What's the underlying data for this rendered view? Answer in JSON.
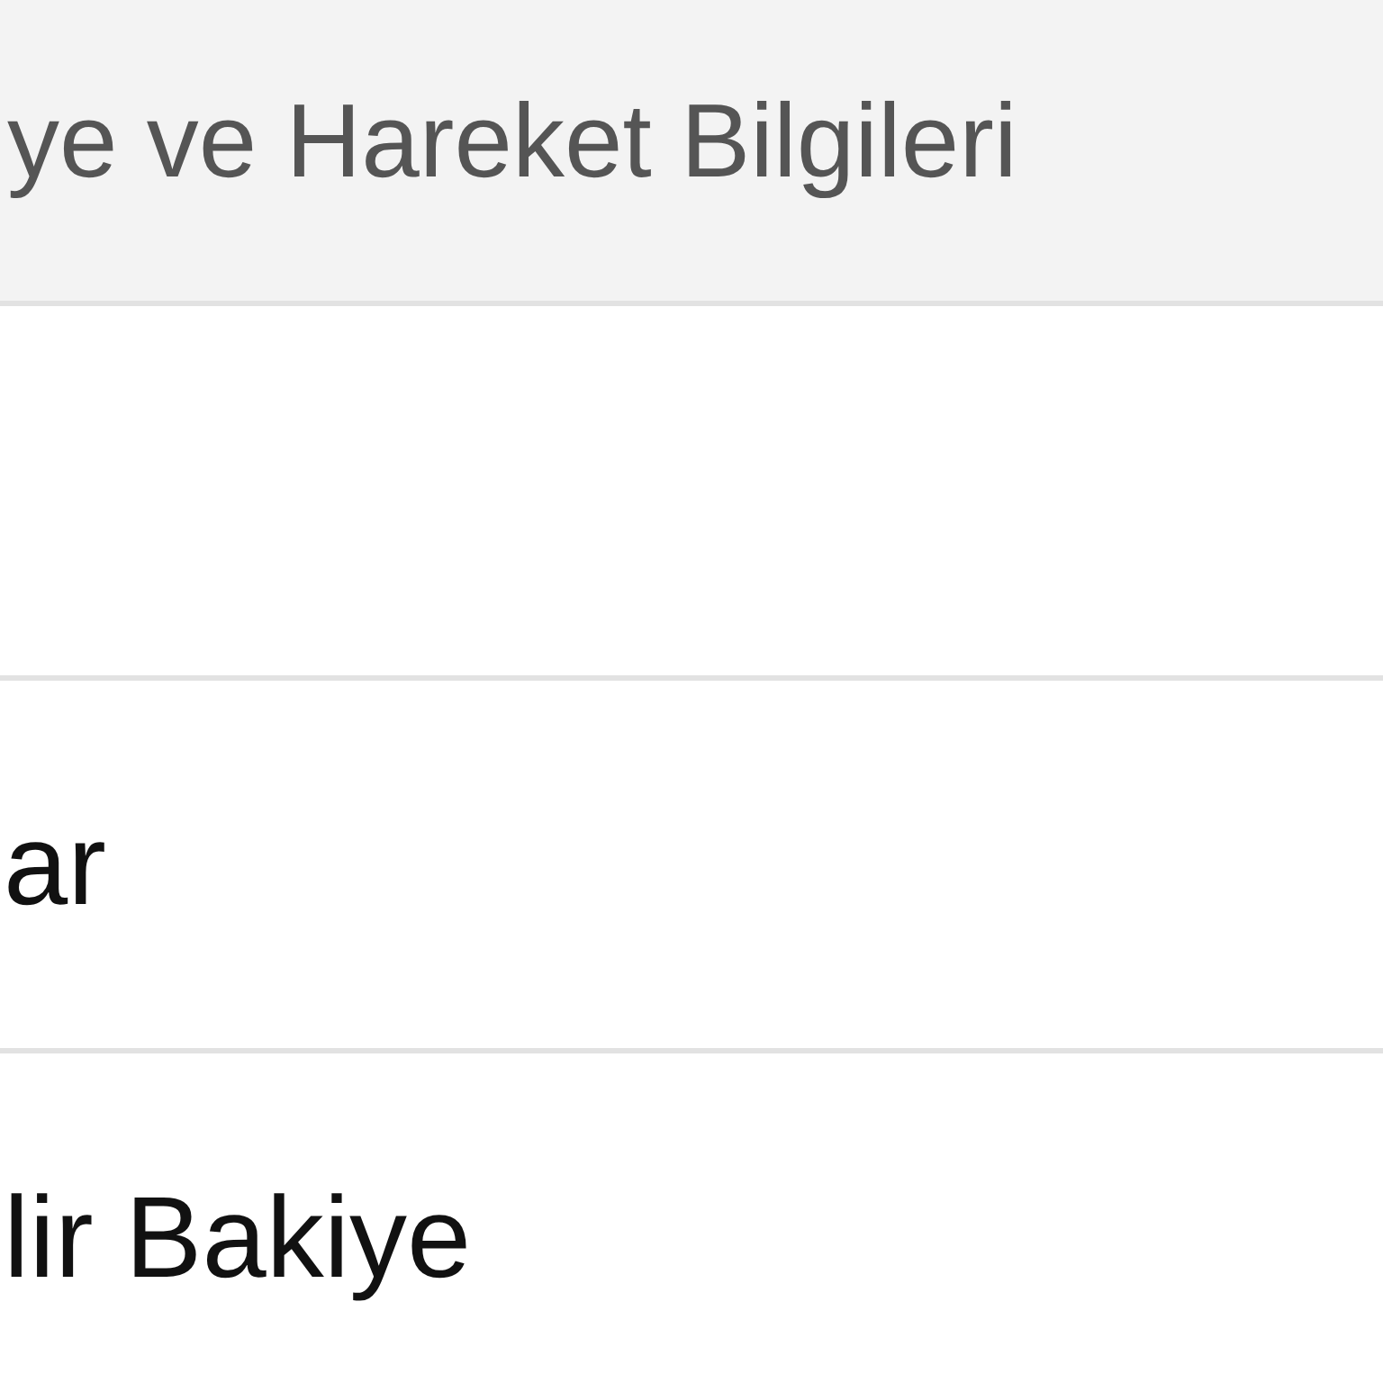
{
  "section_header": {
    "title": "ye ve Hareket Bilgileri"
  },
  "rows": [
    {
      "label": "ar"
    },
    {
      "label": "lir Bakiye"
    }
  ]
}
